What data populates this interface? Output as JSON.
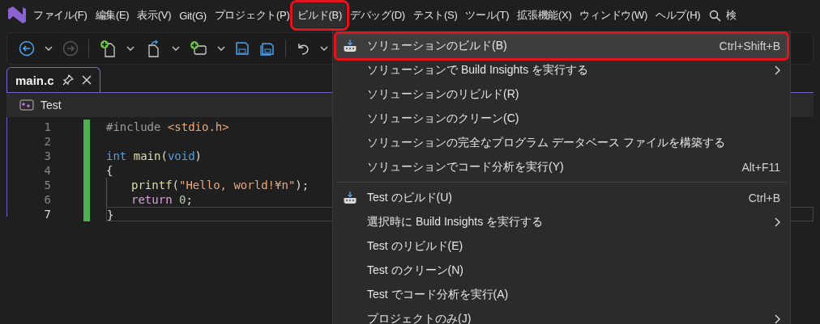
{
  "menu_bar": {
    "items": [
      {
        "label": "ファイル(F)",
        "selected": false,
        "annotated": false
      },
      {
        "label": "編集(E)",
        "selected": false,
        "annotated": false
      },
      {
        "label": "表示(V)",
        "selected": false,
        "annotated": false
      },
      {
        "label": "Git(G)",
        "selected": false,
        "annotated": false
      },
      {
        "label": "プロジェクト(P)",
        "selected": false,
        "annotated": false
      },
      {
        "label": "ビルド(B)",
        "selected": true,
        "annotated": true
      },
      {
        "label": "デバッグ(D)",
        "selected": false,
        "annotated": false
      },
      {
        "label": "テスト(S)",
        "selected": false,
        "annotated": false
      },
      {
        "label": "ツール(T)",
        "selected": false,
        "annotated": false
      },
      {
        "label": "拡張機能(X)",
        "selected": false,
        "annotated": false
      },
      {
        "label": "ウィンドウ(W)",
        "selected": false,
        "annotated": false
      },
      {
        "label": "ヘルプ(H)",
        "selected": false,
        "annotated": false
      }
    ],
    "search_text": "検"
  },
  "tab": {
    "label": "main.c"
  },
  "navigation": {
    "project": "Test"
  },
  "editor": {
    "lines": [
      {
        "number": "1",
        "current": false,
        "indented": false,
        "tokens": [
          {
            "kind": "preprocessor",
            "text": "#include "
          },
          {
            "kind": "string",
            "text": "<stdio.h>"
          }
        ]
      },
      {
        "number": "2",
        "current": false,
        "indented": false
      },
      {
        "number": "3",
        "current": false,
        "indented": false,
        "tokens": [
          {
            "kind": "keyword",
            "text": "int "
          },
          {
            "kind": "function",
            "text": "main"
          },
          {
            "kind": "plain",
            "text": "("
          },
          {
            "kind": "keyword",
            "text": "void"
          },
          {
            "kind": "plain",
            "text": ")"
          }
        ]
      },
      {
        "number": "4",
        "current": false,
        "indented": false,
        "tokens": [
          {
            "kind": "plain",
            "text": "{"
          }
        ]
      },
      {
        "number": "5",
        "current": false,
        "indented": true,
        "tokens": [
          {
            "kind": "function",
            "text": "printf"
          },
          {
            "kind": "plain",
            "text": "("
          },
          {
            "kind": "string",
            "text": "\"Hello, world!¥n\""
          },
          {
            "kind": "plain",
            "text": ");"
          }
        ]
      },
      {
        "number": "6",
        "current": false,
        "indented": true,
        "tokens": [
          {
            "kind": "control",
            "text": "return "
          },
          {
            "kind": "number",
            "text": "0"
          },
          {
            "kind": "plain",
            "text": ";"
          }
        ]
      },
      {
        "number": "7",
        "current": true,
        "indented": false,
        "tokens": [
          {
            "kind": "plain",
            "text": "}"
          }
        ]
      }
    ]
  },
  "dropdown": {
    "items": [
      {
        "kind": "item",
        "label": "ソリューションのビルド(B)",
        "shortcut": "Ctrl+Shift+B",
        "icon": true,
        "submenu": false,
        "selected": true,
        "annotated": true
      },
      {
        "kind": "item",
        "label": "ソリューションで Build Insights を実行する",
        "icon": false,
        "submenu": true,
        "selected": false,
        "annotated": false
      },
      {
        "kind": "item",
        "label": "ソリューションのリビルド(R)",
        "icon": false,
        "submenu": false,
        "selected": false,
        "annotated": false
      },
      {
        "kind": "item",
        "label": "ソリューションのクリーン(C)",
        "icon": false,
        "submenu": false,
        "selected": false,
        "annotated": false
      },
      {
        "kind": "item",
        "label": "ソリューションの完全なプログラム データベース ファイルを構築する",
        "icon": false,
        "submenu": false,
        "selected": false,
        "annotated": false
      },
      {
        "kind": "item",
        "label": "ソリューションでコード分析を実行(Y)",
        "shortcut": "Alt+F11",
        "icon": false,
        "submenu": false,
        "selected": false,
        "annotated": false
      },
      {
        "kind": "separator"
      },
      {
        "kind": "item",
        "label": "Test のビルド(U)",
        "shortcut": "Ctrl+B",
        "icon": true,
        "submenu": false,
        "selected": false,
        "annotated": false
      },
      {
        "kind": "item",
        "label": "選択時に Build Insights を実行する",
        "icon": false,
        "submenu": true,
        "selected": false,
        "annotated": false
      },
      {
        "kind": "item",
        "label": "Test のリビルド(E)",
        "icon": false,
        "submenu": false,
        "selected": false,
        "annotated": false
      },
      {
        "kind": "item",
        "label": "Test のクリーン(N)",
        "icon": false,
        "submenu": false,
        "selected": false,
        "annotated": false
      },
      {
        "kind": "item",
        "label": "Test でコード分析を実行(A)",
        "icon": false,
        "submenu": false,
        "selected": false,
        "annotated": false
      },
      {
        "kind": "item",
        "label": "プロジェクトのみ(J)",
        "icon": false,
        "submenu": true,
        "selected": false,
        "annotated": false
      }
    ]
  }
}
